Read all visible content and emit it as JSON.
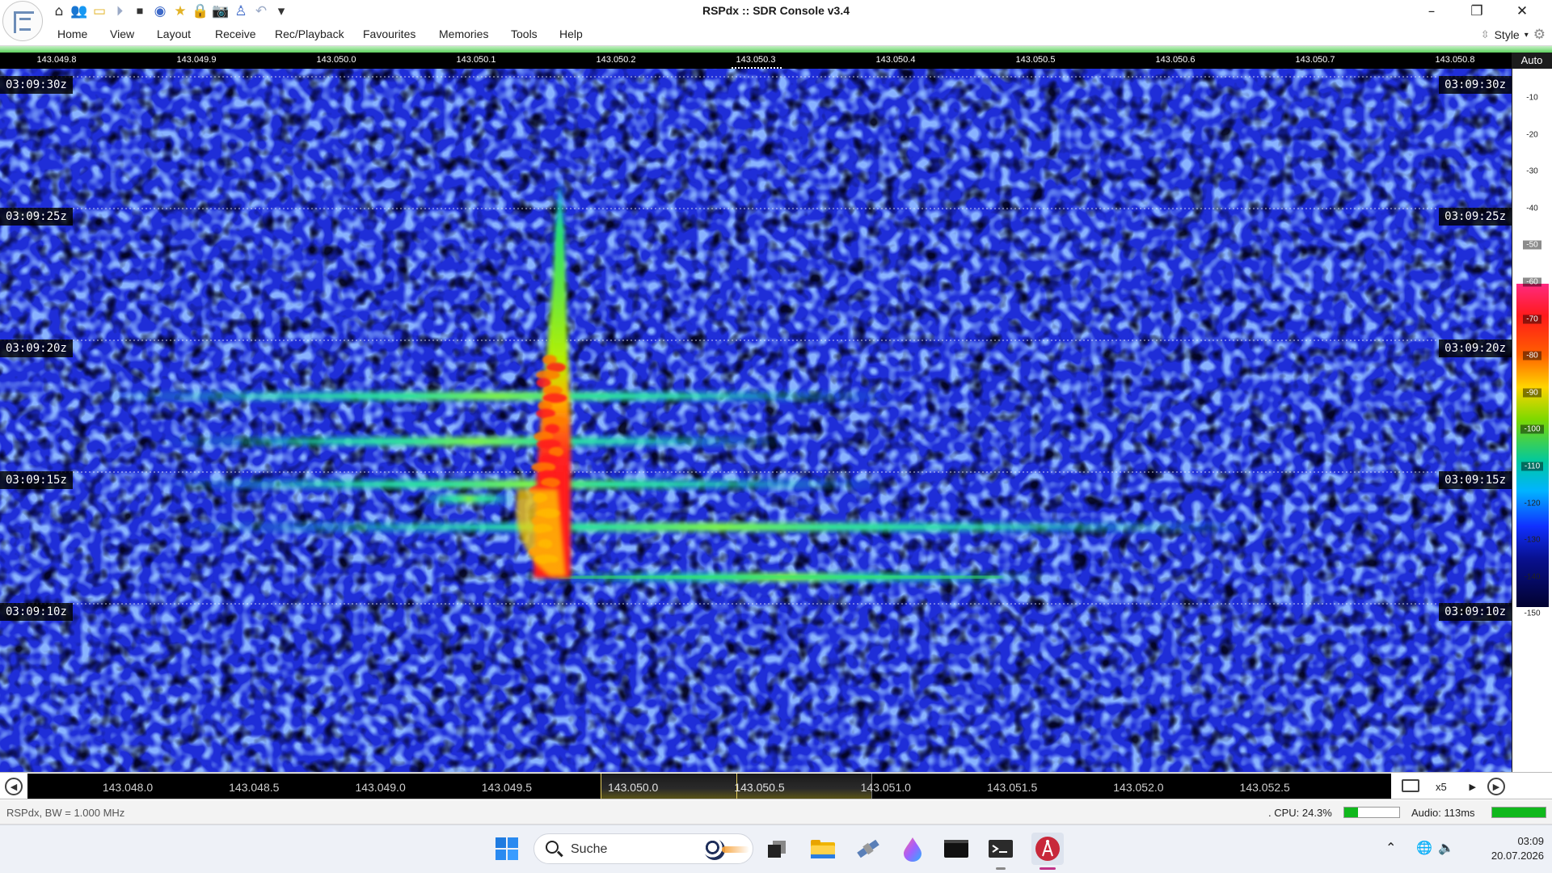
{
  "window": {
    "title": "RSPdx :: SDR Console v3.4"
  },
  "quick_access": [
    {
      "icon": "home-icon",
      "glyph": "⌂"
    },
    {
      "icon": "users-icon",
      "glyph": "👥"
    },
    {
      "icon": "folder-icon",
      "glyph": "▭"
    },
    {
      "icon": "play-icon",
      "glyph": "⏵"
    },
    {
      "icon": "stop-icon",
      "glyph": "⏹"
    },
    {
      "icon": "record-icon",
      "glyph": "◉"
    },
    {
      "icon": "favourite-star-icon",
      "glyph": "★"
    },
    {
      "icon": "lock-icon",
      "glyph": "🔒"
    },
    {
      "icon": "camera-icon",
      "glyph": "📷"
    },
    {
      "icon": "antenna-icon",
      "glyph": "♙"
    },
    {
      "icon": "undo-icon",
      "glyph": "↶"
    },
    {
      "icon": "customize-dropdown-icon",
      "glyph": "▾"
    }
  ],
  "menu": {
    "items": [
      "Home",
      "View",
      "Layout",
      "Receive",
      "Rec/Playback",
      "Favourites",
      "Memories",
      "Tools",
      "Help"
    ],
    "style_label": "Style"
  },
  "colors": {
    "waterfall_background": "#1f2ed8",
    "signal_core": "#ff1e1e",
    "signal_mid": "#ffd000",
    "signal_edge": "#2bd080",
    "status_ok": "#10b81c",
    "ribbon_accent": "#5fd25f"
  },
  "top_scale": {
    "ticks": [
      "143.049.8",
      "143.049.9",
      "143.050.0",
      "143.050.1",
      "143.050.2",
      "143.050.3",
      "143.050.4",
      "143.050.5",
      "143.050.6",
      "143.050.7",
      "143.050.8"
    ],
    "auto_label": "Auto"
  },
  "waterfall": {
    "timestamps": [
      "03:09:30z",
      "03:09:25z",
      "03:09:20z",
      "03:09:15z",
      "03:09:10z"
    ]
  },
  "db_scale": {
    "ticks": [
      "-10",
      "-20",
      "-30",
      "-40",
      "-50",
      "-60",
      "-70",
      "-80",
      "-90",
      "-100",
      "-110",
      "-120",
      "-130",
      "-140",
      "-150"
    ],
    "colorbar_range": [
      "-50",
      "-110"
    ]
  },
  "bottom_scale": {
    "ticks": [
      "143.048.0",
      "143.048.5",
      "143.049.0",
      "143.049.5",
      "143.050.0",
      "143.050.5",
      "143.051.0",
      "143.051.5",
      "143.052.0",
      "143.052.5"
    ],
    "zoom_label": "x5"
  },
  "status": {
    "left": "RSPdx, BW = 1.000 MHz",
    "cpu": ". CPU: 24.3%",
    "cpu_level": 0.243,
    "audio": "Audio: 113ms",
    "audio_level": 1.0
  },
  "taskbar": {
    "search_placeholder": "Suche",
    "time": "03:09",
    "date": "20.07.2026",
    "apps": [
      "windows-start-icon",
      "task-view-icon",
      "file-explorer-icon",
      "satellite-app-icon",
      "color-drop-app-icon",
      "terminal-icon",
      "console-icon",
      "sdr-console-icon"
    ]
  }
}
